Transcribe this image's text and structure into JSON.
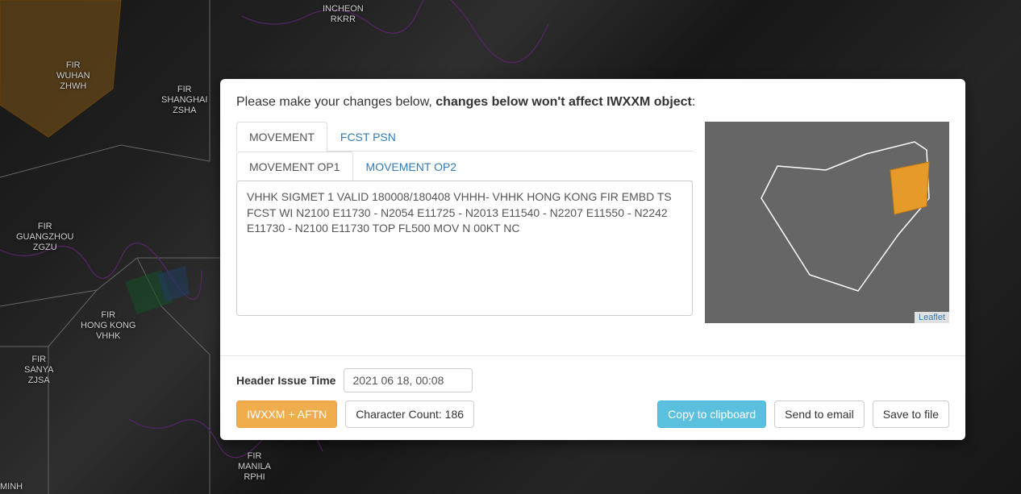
{
  "header": {
    "prefix": "Please make your changes below, ",
    "bold": "changes below won't affect IWXXM object",
    "suffix": ":"
  },
  "tabs1": {
    "movement": "MOVEMENT",
    "fcst_psn": "FCST PSN"
  },
  "tabs2": {
    "op1": "MOVEMENT OP1",
    "op2": "MOVEMENT OP2"
  },
  "sigmet_text": "VHHK SIGMET 1 VALID 180008/180408 VHHH- VHHK HONG KONG FIR EMBD TS FCST WI N2100 E11730 - N2054 E11725 - N2013 E11540 - N2207 E11550 - N2242 E11730 - N2100 E11730 TOP FL500 MOV N 00KT NC",
  "footer": {
    "issue_time_label": "Header Issue Time",
    "issue_time_value": "2021 06 18, 00:08",
    "iwxxm_aftn": "IWXXM + AFTN",
    "char_count": "Character Count: 186",
    "copy": "Copy to clipboard",
    "send": "Send to email",
    "save": "Save to file"
  },
  "minimap": {
    "attribution": "Leaflet"
  },
  "fir_labels": {
    "incheon": "INCHEON\nRKRR",
    "wuhan": "FIR\nWUHAN\nZHWH",
    "shanghai": "FIR\nSHANGHAI\nZSHA",
    "guangzhou": "FIR\nGUANGZHOU\nZGZU",
    "hongkong": "FIR\nHONG KONG\nVHHK",
    "sanya": "FIR\nSANYA\nZJSA",
    "manila": "FIR\nMANILA\nRPHI",
    "minh": "MINH"
  }
}
